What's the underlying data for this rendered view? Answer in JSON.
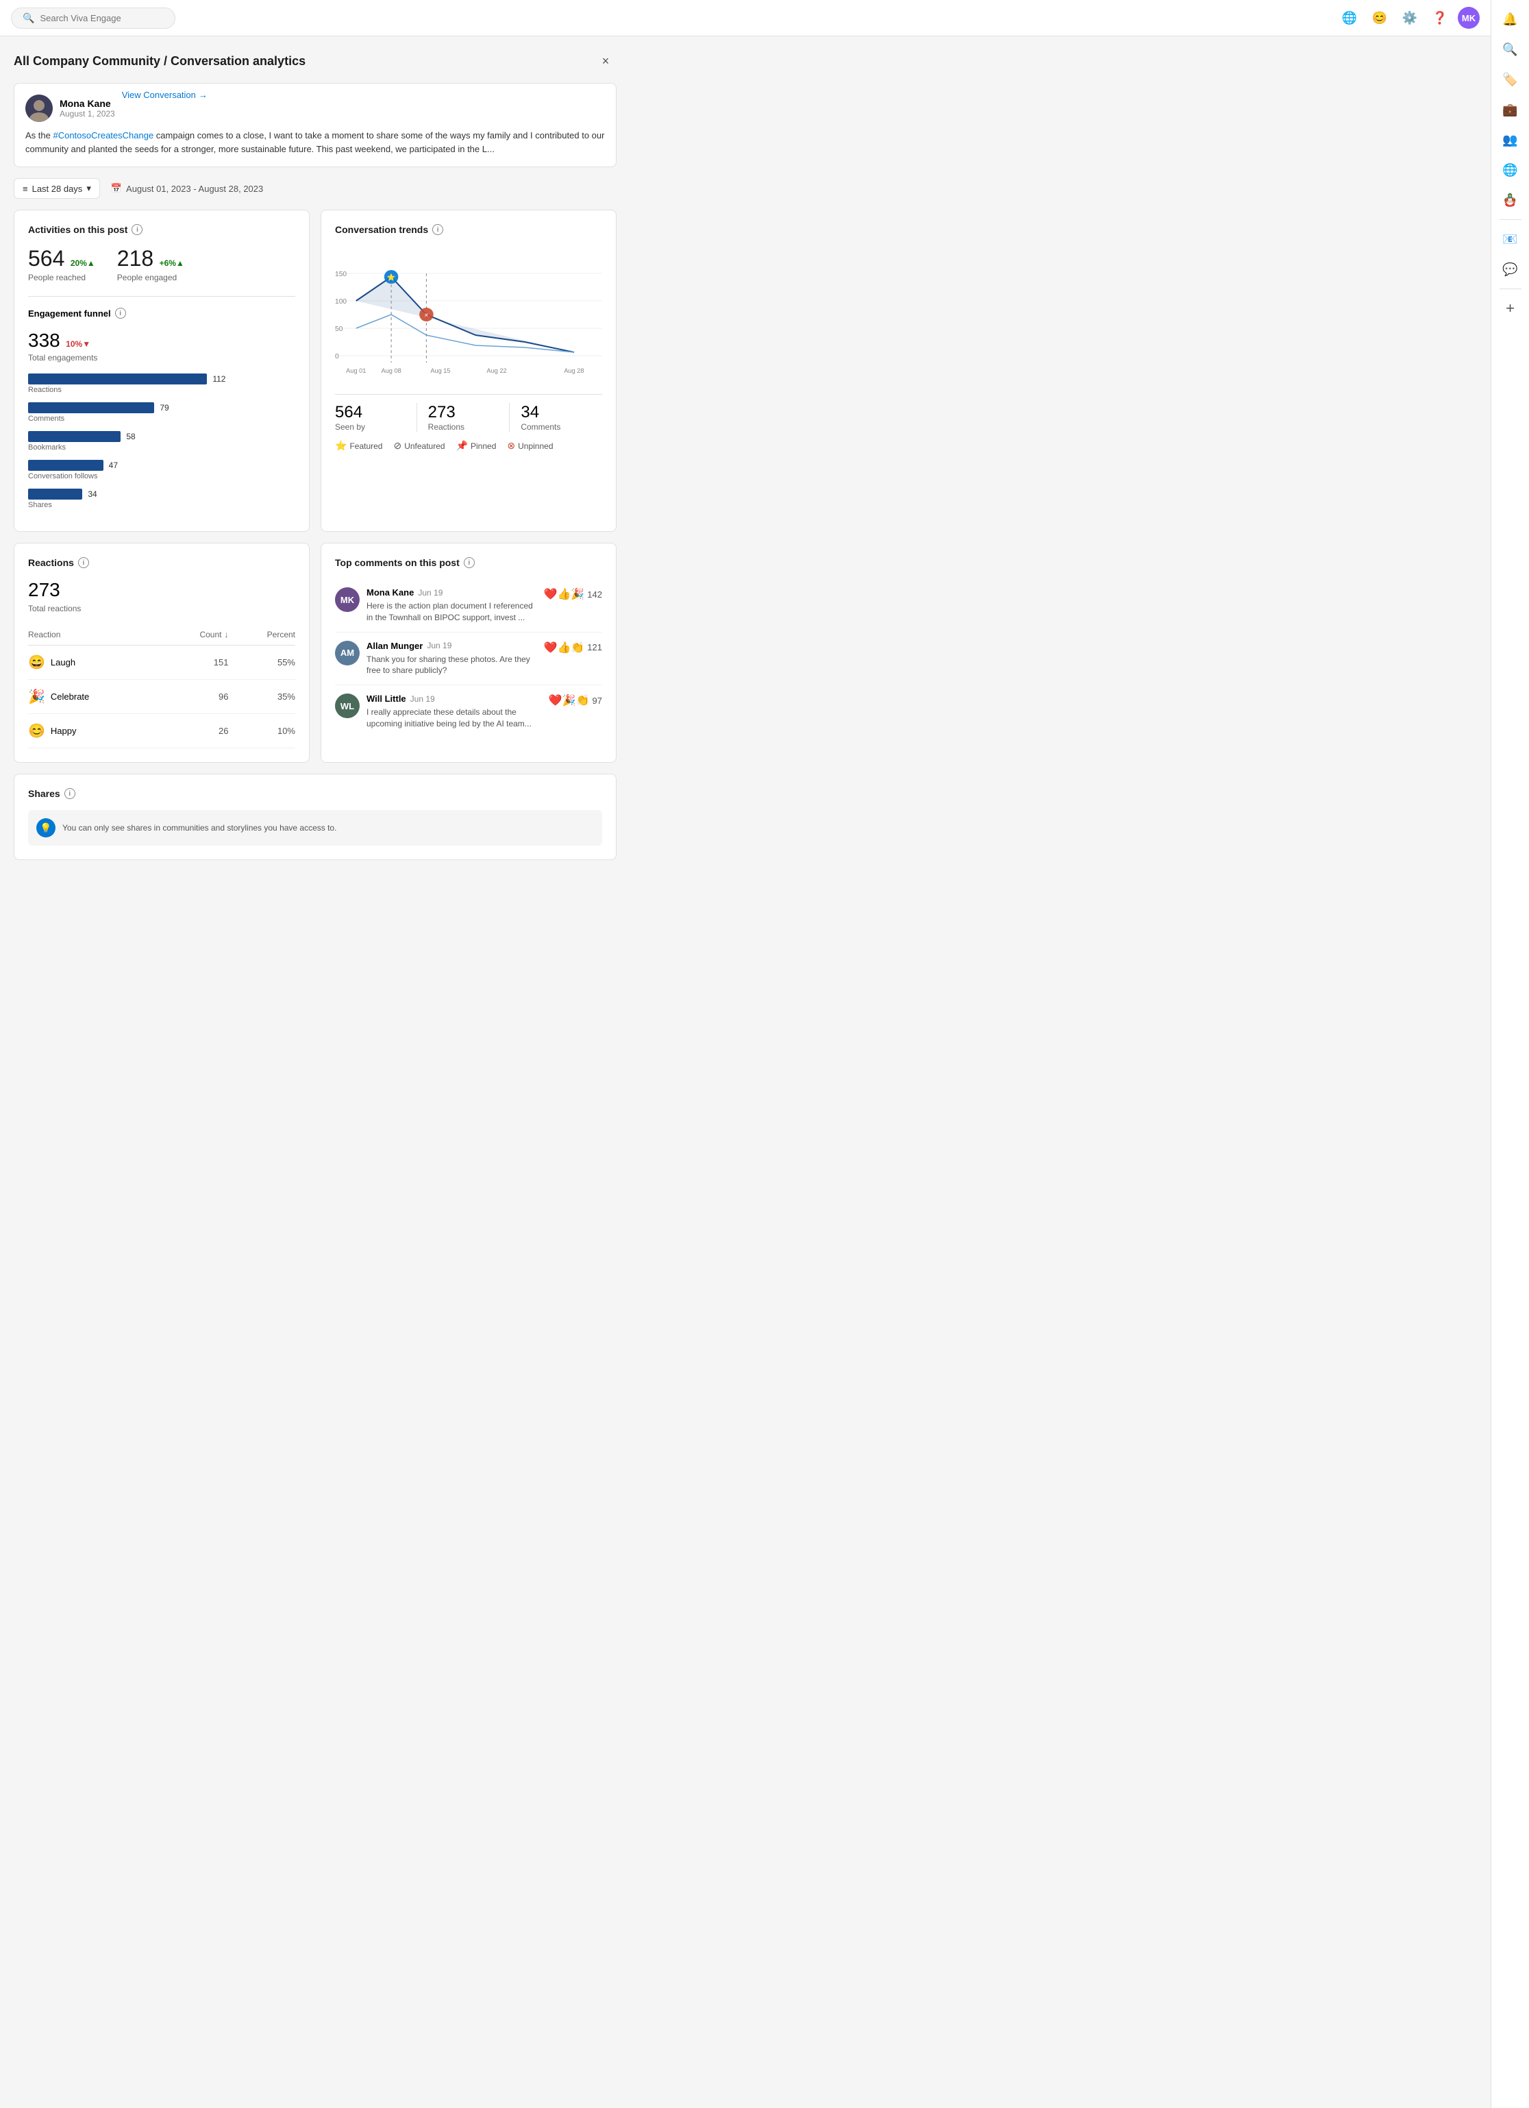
{
  "topbar": {
    "search_placeholder": "Search Viva Engage"
  },
  "page": {
    "title": "All Company Community / Conversation analytics",
    "close_label": "×"
  },
  "post": {
    "author_name": "Mona Kane",
    "author_date": "August 1, 2023",
    "author_initials": "MK",
    "content_before": "As the ",
    "hashtag": "#ContosoCreatesChange",
    "content_after": " campaign comes to a close, I want to take a moment to share some of the ways my family and I contributed to our community and planted the seeds for a stronger, more sustainable future. This past weekend, we participated in the L...",
    "view_conversation": "View Conversation"
  },
  "filter": {
    "period_label": "Last 28 days",
    "date_range": "August 01, 2023 - August 28, 2023"
  },
  "activities": {
    "title": "Activities on this post",
    "people_reached_value": "564",
    "people_reached_change": "20%",
    "people_reached_label": "People reached",
    "people_engaged_value": "218",
    "people_engaged_change": "+6%",
    "people_engaged_label": "People engaged",
    "engagement_funnel_title": "Engagement funnel",
    "total_engagements_value": "338",
    "total_engagements_change": "10%",
    "total_engagements_label": "Total engagements",
    "bars": [
      {
        "label": "Reactions",
        "value": 112,
        "max": 120
      },
      {
        "label": "Comments",
        "value": 79,
        "max": 120
      },
      {
        "label": "Bookmarks",
        "value": 58,
        "max": 120
      },
      {
        "label": "Conversation follows",
        "value": 47,
        "max": 120
      },
      {
        "label": "Shares",
        "value": 34,
        "max": 120
      }
    ]
  },
  "trends": {
    "title": "Conversation trends",
    "x_labels": [
      "Aug 01",
      "Aug 08",
      "Aug 15",
      "Aug 22",
      "Aug 28"
    ],
    "y_labels": [
      "0",
      "50",
      "100",
      "150"
    ],
    "stats": [
      {
        "value": "564",
        "label": "Seen by"
      },
      {
        "value": "273",
        "label": "Reactions"
      },
      {
        "value": "34",
        "label": "Comments"
      }
    ],
    "legend": [
      {
        "icon": "⭐",
        "color": "#0078d4",
        "label": "Featured"
      },
      {
        "icon": "⊘",
        "color": "#666",
        "label": "Unfeatured"
      },
      {
        "icon": "📌",
        "color": "#c84b32",
        "label": "Pinned"
      },
      {
        "icon": "⊗",
        "color": "#c84b32",
        "label": "Unpinned"
      }
    ]
  },
  "reactions": {
    "title": "Reactions",
    "total": "273",
    "total_label": "Total reactions",
    "col_reaction": "Reaction",
    "col_count": "Count",
    "col_percent": "Percent",
    "rows": [
      {
        "emoji": "😄",
        "name": "Laugh",
        "count": 151,
        "percent": "55%"
      },
      {
        "emoji": "🎉",
        "name": "Celebrate",
        "count": 96,
        "percent": "35%"
      },
      {
        "emoji": "😊",
        "name": "Happy",
        "count": 26,
        "percent": "10%"
      }
    ]
  },
  "top_comments": {
    "title": "Top comments on this post",
    "comments": [
      {
        "author": "Mona Kane",
        "date": "Jun 19",
        "initials": "MK",
        "avatar_color": "#6b4c8a",
        "text": "Here is the action plan document I referenced in the Townhall on BIPOC support, invest ...",
        "reaction_count": "142",
        "reactions": "❤️👍🎉"
      },
      {
        "author": "Allan Munger",
        "date": "Jun 19",
        "initials": "AM",
        "avatar_color": "#5a7a9a",
        "text": "Thank you for sharing these photos. Are they free to share publicly?",
        "reaction_count": "121",
        "reactions": "❤️👍👏"
      },
      {
        "author": "Will Little",
        "date": "Jun 19",
        "initials": "WL",
        "avatar_color": "#4a6a5a",
        "text": "I really appreciate these details about the upcoming initiative being led by the AI team...",
        "reaction_count": "97",
        "reactions": "❤️🎉👏"
      }
    ]
  },
  "shares": {
    "title": "Shares",
    "info_text": "You can only see shares in communities and storylines you have access to."
  },
  "sidebar": {
    "icons": [
      {
        "name": "notifications-icon",
        "symbol": "🔔",
        "active": true
      },
      {
        "name": "search-icon",
        "symbol": "🔍",
        "active": false
      },
      {
        "name": "tag-icon",
        "symbol": "🏷️",
        "active": false
      },
      {
        "name": "briefcase-icon",
        "symbol": "💼",
        "active": false
      },
      {
        "name": "people-icon",
        "symbol": "👥",
        "active": false
      },
      {
        "name": "globe-icon",
        "symbol": "🌐",
        "active": false
      },
      {
        "name": "puppet-icon",
        "symbol": "🪆",
        "active": false
      },
      {
        "name": "outlook-icon",
        "symbol": "📧",
        "active": false
      },
      {
        "name": "chat-icon",
        "symbol": "💬",
        "active": false
      },
      {
        "name": "add-icon",
        "symbol": "+",
        "active": false
      }
    ]
  }
}
